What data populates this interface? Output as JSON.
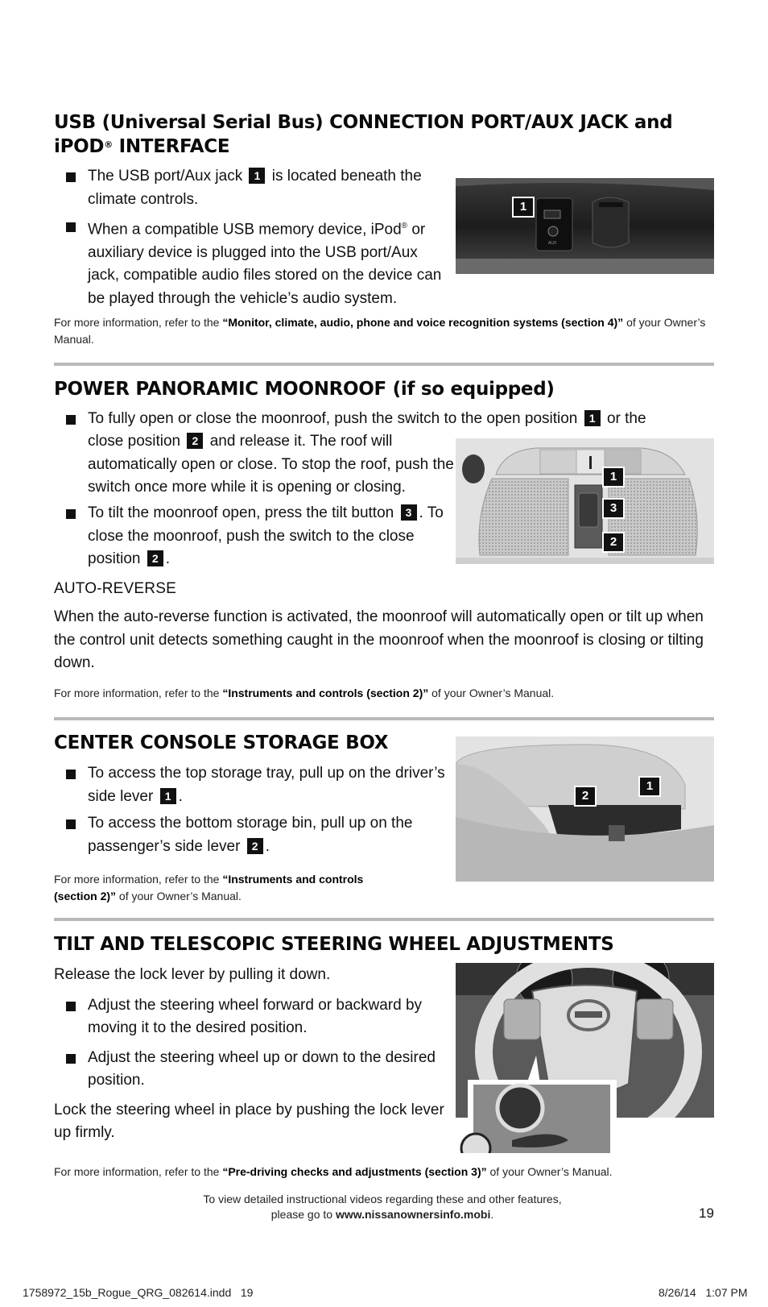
{
  "sections": {
    "usb": {
      "title_line1": "USB (Universal Serial Bus) CONNECTION PORT/AUX JACK and",
      "title_line2_a": "iPOD",
      "title_line2_sup": "®",
      "title_line2_b": " INTERFACE",
      "bullets": [
        {
          "a": "The USB port/Aux jack",
          "badge": "1",
          "b": "is located beneath the climate controls."
        },
        {
          "a": "When a compatible USB memory device, iPod",
          "sup": "®",
          "b": " or auxiliary device is plugged into the USB port/Aux jack, compatible audio files stored on the device can be played through the vehicle’s audio system."
        }
      ],
      "note_prefix": "For more information, refer to the ",
      "note_bold": "“Monitor, climate, audio, phone and voice recognition systems (section 4)”",
      "note_suffix": " of your Owner’s Manual.",
      "photo_label": "usb-aux-port-photo",
      "callouts": [
        "1"
      ]
    },
    "moonroof": {
      "title": "POWER PANORAMIC MOONROOF (if so equipped)",
      "bullet1_a": "To fully open or close the moonroof, push the switch to the open position",
      "bullet1_badge1": "1",
      "bullet1_b": "or the close position",
      "bullet1_badge2": "2",
      "bullet1_c": "and release it. The roof will automatically open or close. To stop the roof, push the switch once more while it is opening or closing.",
      "bullet2_a": "To tilt the moonroof open, press the tilt button",
      "bullet2_badge1": "3",
      "bullet2_b": ". To close the moonroof, push the switch to the close position",
      "bullet2_badge2": "2",
      "bullet2_c": ".",
      "subheading": "AUTO-REVERSE",
      "paragraph": "When the auto-reverse function is activated, the moonroof will automatically open or tilt up when the control unit detects something caught in the moonroof when the moonroof is closing or tilting down.",
      "note_prefix": "For more information, refer to the ",
      "note_bold": "“Instruments and controls (section 2)”",
      "note_suffix": " of your Owner’s Manual.",
      "callouts": [
        "1",
        "3",
        "2"
      ]
    },
    "console": {
      "title": "CENTER CONSOLE STORAGE BOX",
      "bullets": [
        {
          "a": "To access the top storage tray, pull up on the driver’s side lever",
          "badge": "1",
          "b": "."
        },
        {
          "a": "To access the bottom storage bin, pull up on the passenger’s side lever",
          "badge": "2",
          "b": "."
        }
      ],
      "note_prefix": "For more information, refer to the ",
      "note_bold": "“Instruments and controls (section 2)”",
      "note_suffix": " of your Owner’s Manual.",
      "callouts": [
        "2",
        "1"
      ]
    },
    "steering": {
      "title": "TILT AND TELESCOPIC STEERING WHEEL ADJUSTMENTS",
      "intro": "Release the lock lever by pulling it down.",
      "bullets": [
        "Adjust the steering wheel forward or backward by moving it to the desired position.",
        "Adjust the steering wheel up or down to the desired position."
      ],
      "outro": "Lock the steering wheel in place by pushing the lock lever up firmly.",
      "note_prefix": "For more information, refer to the ",
      "note_bold": "“Pre-driving checks and adjustments (section 3)”",
      "note_suffix": " of your Owner’s Manual."
    }
  },
  "footer": {
    "line1": "To view detailed instructional videos regarding these and other features,",
    "line2_prefix": "please go to ",
    "line2_link": "www.nissanownersinfo.mobi",
    "line2_suffix": ".",
    "page_number": "19"
  },
  "slug": {
    "file": "1758972_15b_Rogue_QRG_082614.indd   19",
    "timestamp": "8/26/14   1:07 PM"
  },
  "colors": {
    "divider": "#b9b9b9",
    "badge": "#111111",
    "text": "#111111"
  }
}
